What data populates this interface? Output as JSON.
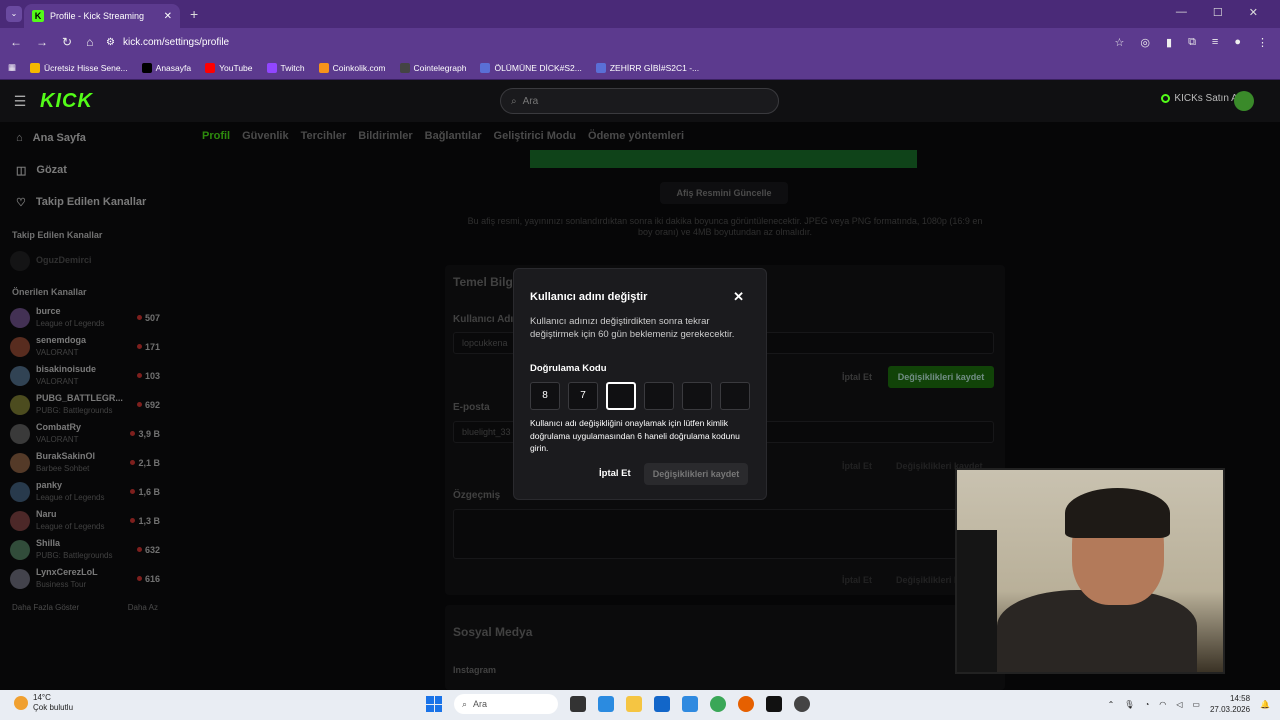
{
  "browser": {
    "tab_title": "Profile - Kick Streaming",
    "url": "kick.com/settings/profile",
    "bookmarks": [
      "Ücretsiz Hisse Sene...",
      "Anasayfa",
      "YouTube",
      "Twitch",
      "Coinkolik.com",
      "Cointelegraph",
      "ÖLÜMÜNE DİCK#S2...",
      "ZEHİRR GİBİ#S2C1 -..."
    ],
    "bookmark_colors": [
      "#f5b800",
      "#000000",
      "#ff0000",
      "#9146ff",
      "#f7931a",
      "#444444",
      "#5a6fd6",
      "#5a6fd6"
    ]
  },
  "header": {
    "logo": "KICK",
    "search_placeholder": "Ara",
    "kicks_label": "KICKs Satın Al"
  },
  "sidebar": {
    "nav": [
      {
        "label": "Ana Sayfa",
        "icon": "home-icon"
      },
      {
        "label": "Gözat",
        "icon": "browse-icon"
      },
      {
        "label": "Takip Edilen Kanallar",
        "icon": "heart-icon"
      }
    ],
    "followed_title": "Takip Edilen Kanallar",
    "followed": [
      {
        "name": "OguzDemirci",
        "status": ""
      }
    ],
    "recommended_title": "Önerilen Kanallar",
    "recommended": [
      {
        "name": "burce",
        "game": "League of Legends",
        "viewers": "507"
      },
      {
        "name": "senemdoga",
        "game": "VALORANT",
        "viewers": "171"
      },
      {
        "name": "bisakinoisude",
        "game": "VALORANT",
        "viewers": "103"
      },
      {
        "name": "PUBG_BATTLEGR...",
        "game": "PUBG: Battlegrounds",
        "viewers": "692"
      },
      {
        "name": "CombatRy",
        "game": "VALORANT",
        "viewers": "3,9 B"
      },
      {
        "name": "BurakSakinOl",
        "game": "Barbee Sohbet",
        "viewers": "2,1 B"
      },
      {
        "name": "panky",
        "game": "League of Legends",
        "viewers": "1,6 B"
      },
      {
        "name": "Naru",
        "game": "League of Legends",
        "viewers": "1,3 B"
      },
      {
        "name": "Shilla",
        "game": "PUBG: Battlegrounds",
        "viewers": "632"
      },
      {
        "name": "LynxCerezLoL",
        "game": "Business Tour",
        "viewers": "616"
      }
    ],
    "show_more": "Daha Fazla Göster",
    "show_less": "Daha Az"
  },
  "settings_tabs": [
    "Profil",
    "Güvenlik",
    "Tercihler",
    "Bildirimler",
    "Bağlantılar",
    "Geliştirici Modu",
    "Ödeme yöntemleri"
  ],
  "profile": {
    "banner_button": "Afiş Resmini Güncelle",
    "banner_hint": "Bu afiş resmi, yayınınızı sonlandırdıktan sonra iki dakika boyunca görüntülenecektir. JPEG veya PNG formatında, 1080p (16:9 en boy oranı) ve 4MB boyutundan az olmalıdır.",
    "basic_info_title": "Temel Bilgi",
    "username_label": "Kullanıcı Adı",
    "username_value": "lopcukkena",
    "cancel": "İptal Et",
    "save": "Değişiklikleri kaydet",
    "email_label": "E-posta",
    "email_value": "bluelight_33",
    "bio_label": "Özgeçmiş",
    "social_title": "Sosyal Medya",
    "instagram_label": "Instagram"
  },
  "modal": {
    "title": "Kullanıcı adını değiştir",
    "description": "Kullanıcı adınızı değiştirdikten sonra tekrar değiştirmek için 60 gün beklemeniz gerekecektir.",
    "code_label": "Doğrulama Kodu",
    "code_digits": [
      "8",
      "7",
      "",
      "",
      "",
      ""
    ],
    "note": "Kullanıcı adı değişikliğini onaylamak için lütfen kimlik doğrulama uygulamasından 6 haneli doğrulama kodunu girin.",
    "cancel": "İptal Et",
    "save": "Değişiklikleri kaydet"
  },
  "taskbar": {
    "temp": "14°C",
    "weather": "Çok bulutlu",
    "search": "Ara",
    "time": "14:58",
    "date": "27.03.2026"
  }
}
